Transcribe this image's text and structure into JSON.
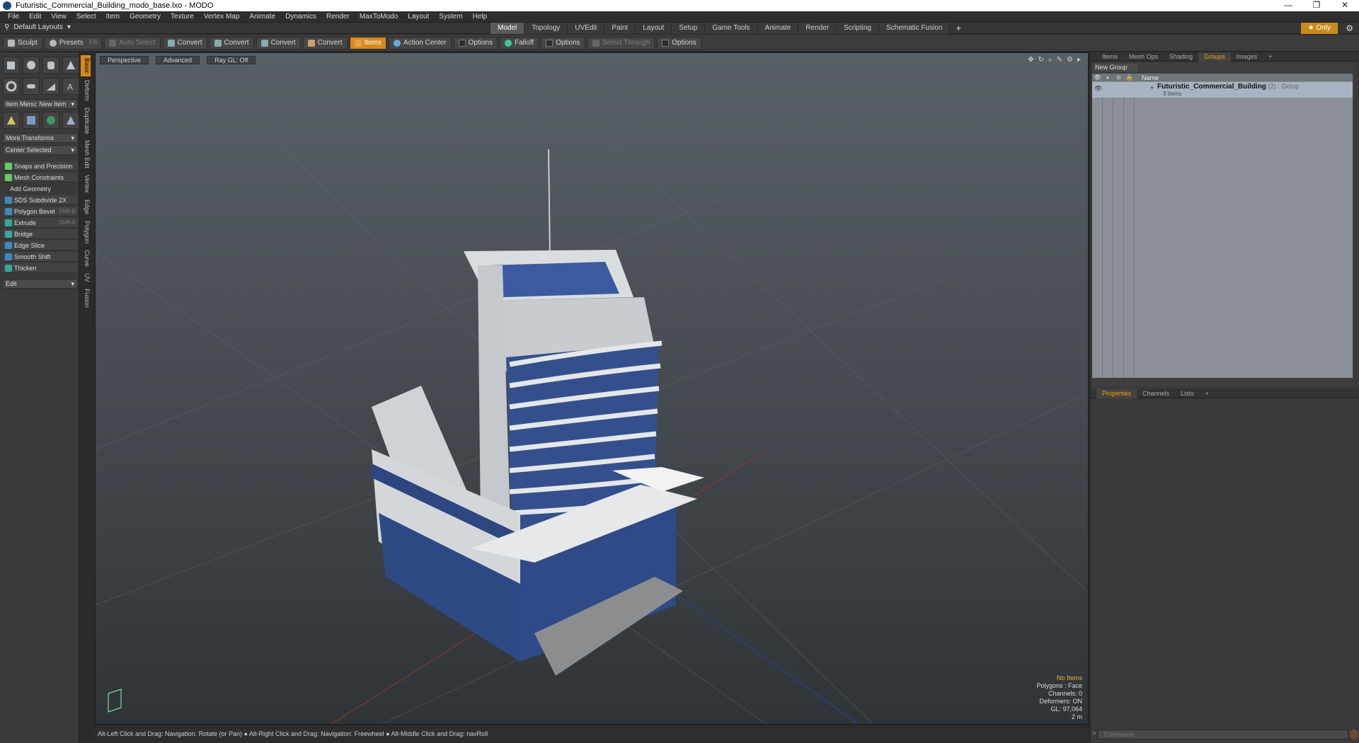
{
  "window": {
    "title": "Futuristic_Commercial_Building_modo_base.lxo - MODO",
    "controls": [
      "—",
      "❐",
      "✕"
    ]
  },
  "menu": [
    "File",
    "Edit",
    "View",
    "Select",
    "Item",
    "Geometry",
    "Texture",
    "Vertex Map",
    "Animate",
    "Dynamics",
    "Render",
    "MaxToModo",
    "Layout",
    "System",
    "Help"
  ],
  "layoutbar": {
    "dropdown": "Default Layouts",
    "tabs": [
      "Model",
      "Topology",
      "UVEdit",
      "Paint",
      "Layout",
      "Setup",
      "Game Tools",
      "Animate",
      "Render",
      "Scripting",
      "Schematic Fusion"
    ],
    "active_tab": "Model",
    "plus": "+",
    "only_label": "★ Only"
  },
  "toolbar": {
    "sculpt": "Sculpt",
    "presets": "Presets",
    "presets_key": "F6",
    "auto_select": "Auto Select",
    "convert1": "Convert",
    "convert2": "Convert",
    "convert3": "Convert",
    "convert4": "Convert",
    "items": "Items",
    "action_center": "Action Center",
    "options1": "Options",
    "falloff": "Falloff",
    "options2": "Options",
    "select_through": "Select Through",
    "options3": "Options"
  },
  "leftpanel": {
    "item_menu": "Item Menu: New Item",
    "more_transforms": "More Transforms",
    "center_selected": "Center Selected",
    "snaps": "Snaps and Precision",
    "mesh_constraints": "Mesh Constraints",
    "add_geometry": "Add Geometry",
    "tools": [
      {
        "label": "SDS Subdivide 2X",
        "key": ""
      },
      {
        "label": "Polygon Bevel",
        "key": "Shift-B"
      },
      {
        "label": "Extrude",
        "key": "Shift-X"
      },
      {
        "label": "Bridge",
        "key": ""
      },
      {
        "label": "Edge Slice",
        "key": ""
      },
      {
        "label": "Smooth Shift",
        "key": ""
      },
      {
        "label": "Thicken",
        "key": ""
      }
    ],
    "edit": "Edit",
    "vtabs": [
      "Basic",
      "Deform",
      "Duplicate",
      "Mesh Edit",
      "Vertex",
      "Edge",
      "Polygon",
      "Curve",
      "UV",
      "Fusion"
    ]
  },
  "viewport": {
    "perspective": "Perspective",
    "advanced": "Advanced",
    "raygl": "Ray GL: Off",
    "stats": {
      "no_items": "No Items",
      "polygons": "Polygons : Face",
      "channels": "Channels: 0",
      "deformers": "Deformers: ON",
      "gl": "GL: 97,064",
      "dist": "2 m"
    }
  },
  "statusbar": "Alt-Left Click and Drag: Navigation: Rotate (or Pan) ● Alt-Right Click and Drag: Navigation: Freewheel ● Alt-Middle Click and Drag: navRoll",
  "rightpanel": {
    "tabs": [
      "Items",
      "Mesh Ops",
      "Shading",
      "Groups",
      "Images",
      "+"
    ],
    "active_tab": "Groups",
    "new_group": "New Group",
    "name_header": "Name",
    "group_name": "Futuristic_Commercial_Building",
    "group_count": "(2) : Group",
    "group_sub": "3 Items",
    "props_tabs": [
      "Properties",
      "Channels",
      "Lists",
      "+"
    ],
    "props_active": "Properties",
    "command_placeholder": "Command"
  }
}
